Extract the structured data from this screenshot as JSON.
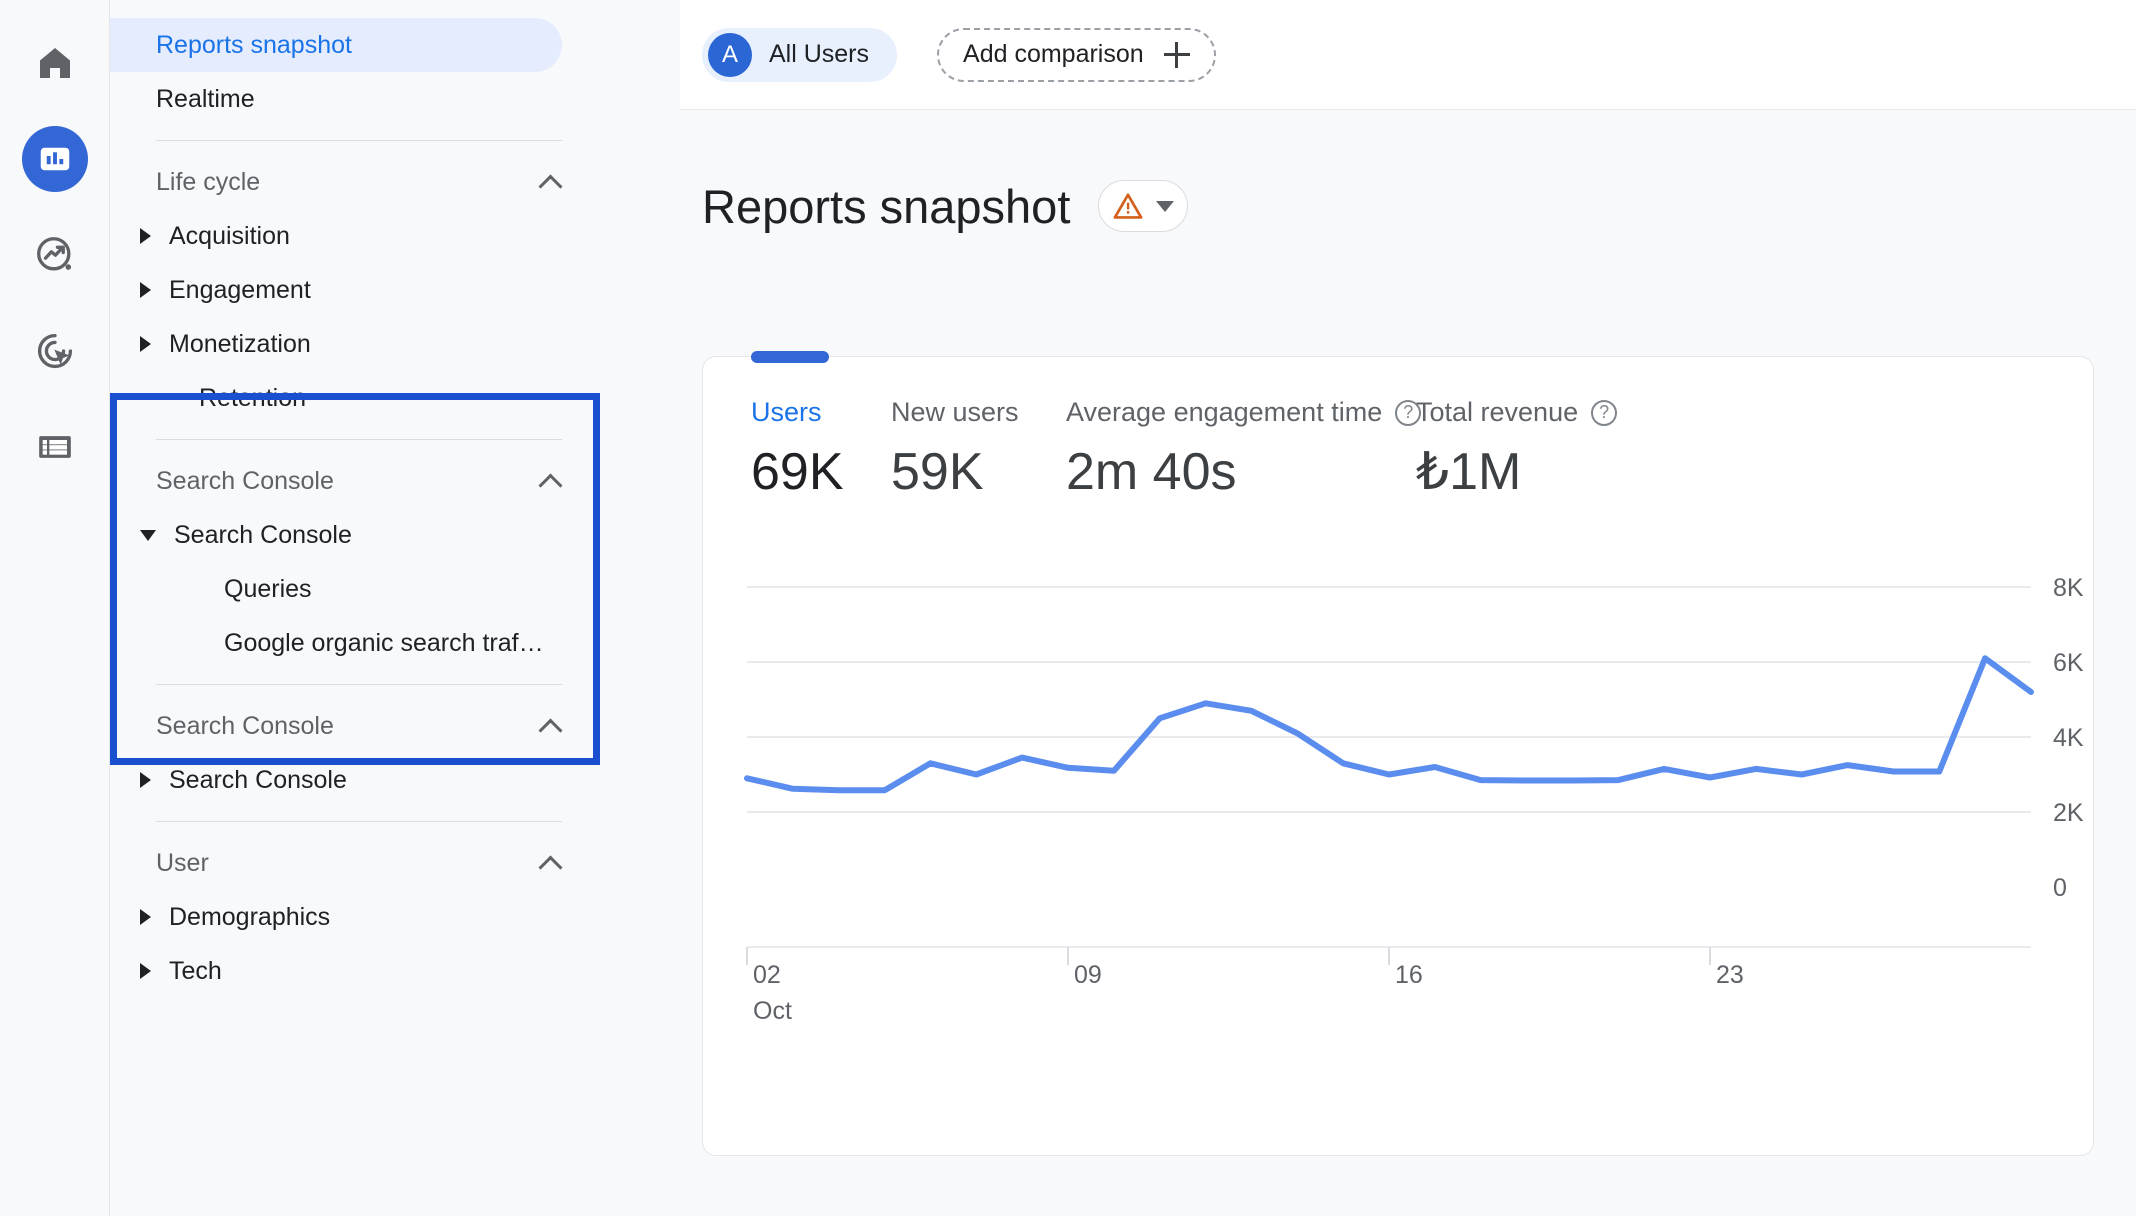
{
  "rail": {
    "items": [
      {
        "name": "home-icon",
        "label": "Home",
        "active": false
      },
      {
        "name": "reports-icon",
        "label": "Reports",
        "active": true
      },
      {
        "name": "explore-icon",
        "label": "Explore",
        "active": false
      },
      {
        "name": "advertising-icon",
        "label": "Advertising",
        "active": false
      },
      {
        "name": "library-icon",
        "label": "Library",
        "active": false
      }
    ]
  },
  "sidebar": {
    "top_items": [
      {
        "label": "Reports snapshot",
        "selected": true
      },
      {
        "label": "Realtime",
        "selected": false
      }
    ],
    "sections": [
      {
        "title": "Life cycle",
        "expanded": true,
        "items": [
          {
            "label": "Acquisition",
            "caret": "right"
          },
          {
            "label": "Engagement",
            "caret": "right"
          },
          {
            "label": "Monetization",
            "caret": "right"
          },
          {
            "label": "Retention",
            "caret": "none"
          }
        ]
      },
      {
        "title": "Search Console",
        "expanded": true,
        "items": [
          {
            "label": "Search Console",
            "caret": "down"
          },
          {
            "label": "Queries",
            "caret": "none",
            "leaf": true
          },
          {
            "label": "Google organic search traf…",
            "caret": "none",
            "leaf": true
          }
        ]
      },
      {
        "title": "Search Console",
        "expanded": true,
        "items": [
          {
            "label": "Search Console",
            "caret": "right"
          }
        ]
      },
      {
        "title": "User",
        "expanded": true,
        "items": [
          {
            "label": "Demographics",
            "caret": "right"
          },
          {
            "label": "Tech",
            "caret": "right"
          }
        ]
      }
    ],
    "highlight_color": "#1a4fd0"
  },
  "topbar": {
    "audience_chip": {
      "avatar_letter": "A",
      "label": "All Users"
    },
    "add_comparison": {
      "label": "Add comparison",
      "icon": "plus-icon"
    }
  },
  "header": {
    "title": "Reports snapshot",
    "warning_icon": "warning-triangle-icon",
    "dropdown_icon": "chevron-down-icon"
  },
  "card": {
    "metrics": [
      {
        "label": "Users",
        "value": "69K",
        "active": true,
        "help": false
      },
      {
        "label": "New users",
        "value": "59K",
        "active": false,
        "help": false
      },
      {
        "label": "Average engagement time",
        "value": "2m 40s",
        "active": false,
        "help": true
      },
      {
        "label": "Total revenue",
        "value": "₺1M",
        "active": false,
        "help": true
      }
    ]
  },
  "chart_data": {
    "type": "line",
    "title": "",
    "xlabel": "",
    "ylabel": "",
    "series": [
      {
        "name": "Users",
        "color": "#5b8def",
        "values": [
          2900,
          2620,
          2580,
          2580,
          3300,
          3000,
          3450,
          3180,
          3100,
          4500,
          4900,
          4700,
          4100,
          3300,
          3000,
          3200,
          2850,
          2840,
          2840,
          2850,
          3150,
          2920,
          3150,
          3000,
          3250,
          3080,
          3080,
          6100,
          5200
        ]
      }
    ],
    "x": [
      "02",
      "03",
      "04",
      "05",
      "06",
      "07",
      "08",
      "09",
      "10",
      "11",
      "12",
      "13",
      "14",
      "15",
      "16",
      "17",
      "18",
      "19",
      "20",
      "21",
      "22",
      "23",
      "24",
      "25",
      "26",
      "27",
      "28",
      "29",
      "30"
    ],
    "xtick_labels": [
      {
        "pos": 0,
        "line1": "02",
        "line2": "Oct"
      },
      {
        "pos": 7,
        "line1": "09",
        "line2": ""
      },
      {
        "pos": 14,
        "line1": "16",
        "line2": ""
      },
      {
        "pos": 21,
        "line1": "23",
        "line2": ""
      }
    ],
    "ytick_labels": [
      "8K",
      "6K",
      "4K",
      "2K",
      "0"
    ],
    "ylim": [
      0,
      8000
    ],
    "grid": true,
    "legend": "none"
  }
}
